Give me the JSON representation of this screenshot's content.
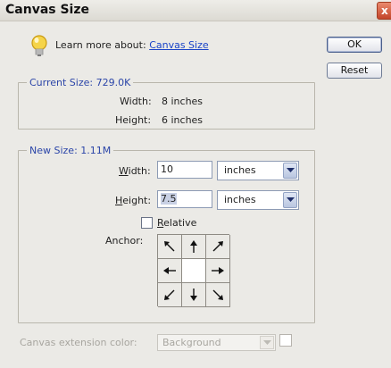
{
  "window": {
    "title": "Canvas Size",
    "close_label": "x"
  },
  "learn": {
    "prefix": "Learn more about:",
    "link": "Canvas Size"
  },
  "buttons": {
    "ok": "OK",
    "reset": "Reset"
  },
  "current_size": {
    "label": "Current Size: 729.0K",
    "width_label": "Width:",
    "width_value": "8 inches",
    "height_label": "Height:",
    "height_value": "6 inches"
  },
  "new_size": {
    "label": "New Size: 1.11M",
    "width_label_u": "W",
    "width_label_rest": "idth:",
    "width_value": "10",
    "width_unit": "inches",
    "height_label_u": "H",
    "height_label_rest": "eight:",
    "height_value": "7.5",
    "height_unit": "inches",
    "relative_u": "R",
    "relative_rest": "elative",
    "relative_checked": false,
    "anchor_label": "Anchor:"
  },
  "extension": {
    "label": "Canvas extension color:",
    "value": "Background",
    "enabled": false
  },
  "icons": {
    "bulb": "lightbulb-icon",
    "anchor": [
      "arrow-up-left-icon",
      "arrow-up-icon",
      "arrow-up-right-icon",
      "arrow-left-icon",
      "anchor-center",
      "arrow-right-icon",
      "arrow-down-left-icon",
      "arrow-down-icon",
      "arrow-down-right-icon"
    ]
  },
  "colors": {
    "accent": "#2b45a8",
    "link": "#1a44c8",
    "background": "#ebeae6"
  }
}
